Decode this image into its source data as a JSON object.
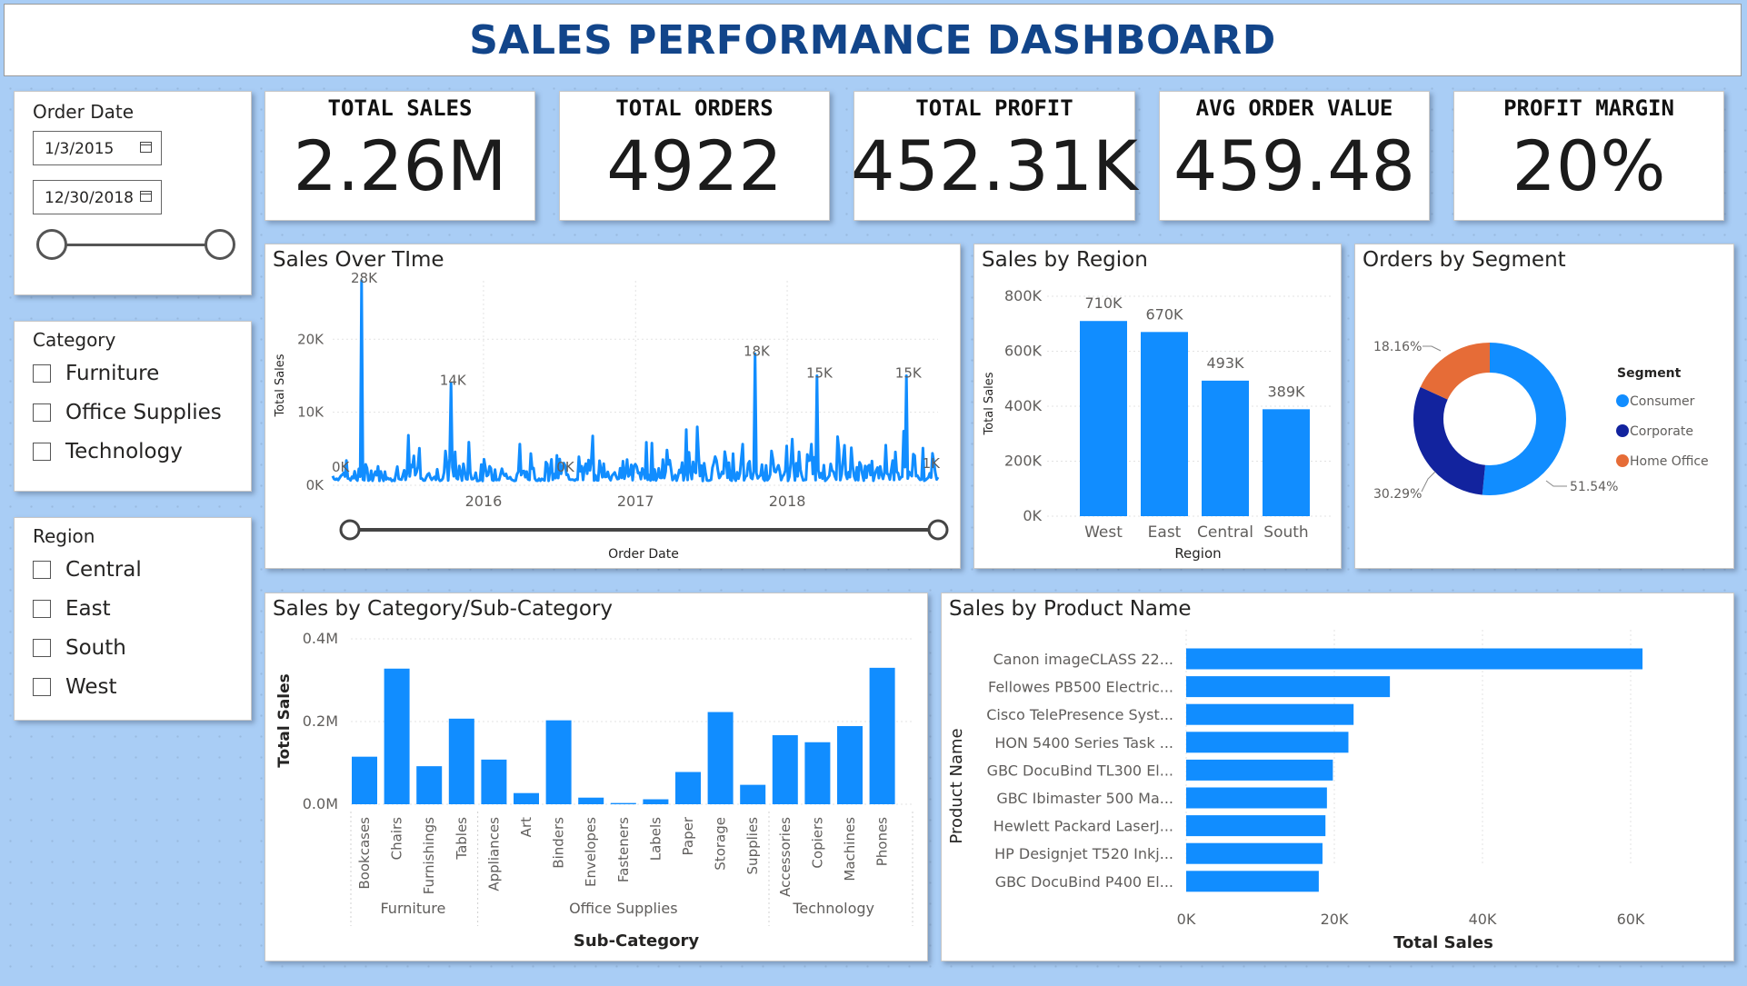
{
  "dashboard_title": "SALES PERFORMANCE DASHBOARD",
  "kpis": [
    {
      "label": "TOTAL SALES",
      "value": "2.26M"
    },
    {
      "label": "TOTAL ORDERS",
      "value": "4922"
    },
    {
      "label": "TOTAL PROFIT",
      "value": "452.31K"
    },
    {
      "label": "AVG ORDER VALUE",
      "value": "459.48"
    },
    {
      "label": "PROFIT MARGIN",
      "value": "20%"
    }
  ],
  "order_date_slicer": {
    "title": "Order Date",
    "start": "1/3/2015",
    "end": "12/30/2018"
  },
  "category_slicer": {
    "title": "Category",
    "items": [
      "Furniture",
      "Office Supplies",
      "Technology"
    ]
  },
  "region_slicer": {
    "title": "Region",
    "items": [
      "Central",
      "East",
      "South",
      "West"
    ]
  },
  "colors": {
    "accent": "#118dff",
    "dark_blue": "#12239e",
    "orange": "#e66c37",
    "title_blue": "#12458a"
  },
  "chart_data": [
    {
      "id": "sales_over_time",
      "type": "line",
      "title": "Sales Over TIme",
      "xlabel": "Order Date",
      "ylabel": "Total Sales",
      "x_ticks": [
        "2016",
        "2017",
        "2018"
      ],
      "y_ticks": [
        "0K",
        "10K",
        "20K"
      ],
      "ylim": [
        0,
        28000
      ],
      "annotations": [
        "0K",
        "28K",
        "14K",
        "0K",
        "18K",
        "15K",
        "15K",
        "1K"
      ],
      "peaks": [
        {
          "x": "2015-03",
          "y": 28000,
          "label": "28K"
        },
        {
          "x": "2015-10",
          "y": 14000,
          "label": "14K"
        },
        {
          "x": "2017-10",
          "y": 18000,
          "label": "18K"
        },
        {
          "x": "2018-03",
          "y": 15000,
          "label": "15K"
        },
        {
          "x": "2018-10",
          "y": 15000,
          "label": "15K"
        }
      ]
    },
    {
      "id": "sales_by_region",
      "type": "bar",
      "title": "Sales by Region",
      "xlabel": "Region",
      "ylabel": "Total Sales",
      "categories": [
        "West",
        "East",
        "Central",
        "South"
      ],
      "values": [
        710000,
        670000,
        493000,
        389000
      ],
      "data_labels": [
        "710K",
        "670K",
        "493K",
        "389K"
      ],
      "y_ticks": [
        "0K",
        "200K",
        "400K",
        "600K",
        "800K"
      ],
      "ylim": [
        0,
        800000
      ]
    },
    {
      "id": "orders_by_segment",
      "type": "pie",
      "title": "Orders by Segment",
      "legend_title": "Segment",
      "legend_position": "right",
      "labels": [
        "Consumer",
        "Corporate",
        "Home Office"
      ],
      "values": [
        51.54,
        30.29,
        18.16
      ],
      "data_labels": [
        "51.54%",
        "30.29%",
        "18.16%"
      ]
    },
    {
      "id": "sales_by_subcategory",
      "type": "bar",
      "title": "Sales by Category/Sub-Category",
      "xlabel": "Sub-Category",
      "ylabel": "Total Sales",
      "y_ticks": [
        "0.0M",
        "0.2M",
        "0.4M"
      ],
      "ylim": [
        0,
        0.4
      ],
      "groups": [
        {
          "name": "Furniture",
          "categories": [
            "Bookcases",
            "Chairs",
            "Furnishings",
            "Tables"
          ],
          "values": [
            0.115,
            0.328,
            0.092,
            0.207
          ]
        },
        {
          "name": "Office Supplies",
          "categories": [
            "Appliances",
            "Art",
            "Binders",
            "Envelopes",
            "Fasteners",
            "Labels",
            "Paper",
            "Storage",
            "Supplies"
          ],
          "values": [
            0.108,
            0.027,
            0.203,
            0.016,
            0.003,
            0.012,
            0.078,
            0.223,
            0.047
          ]
        },
        {
          "name": "Technology",
          "categories": [
            "Accessories",
            "Copiers",
            "Machines",
            "Phones"
          ],
          "values": [
            0.167,
            0.15,
            0.189,
            0.33
          ]
        }
      ]
    },
    {
      "id": "sales_by_product",
      "type": "bar",
      "orientation": "horizontal",
      "title": "Sales by Product Name",
      "xlabel": "Total Sales",
      "ylabel": "Product Name",
      "categories": [
        "Canon imageCLASS 22...",
        "Fellowes PB500 Electric...",
        "Cisco TelePresence Syst...",
        "HON 5400 Series Task ...",
        "GBC DocuBind TL300 El...",
        "GBC Ibimaster 500 Ma...",
        "Hewlett Packard LaserJ...",
        "HP Designjet T520 Inkj...",
        "GBC DocuBind P400 El..."
      ],
      "values": [
        61600,
        27500,
        22600,
        21900,
        19800,
        19000,
        18800,
        18400,
        17900
      ],
      "x_ticks": [
        "0K",
        "20K",
        "40K",
        "60K"
      ],
      "xlim": [
        0,
        60000
      ]
    }
  ]
}
